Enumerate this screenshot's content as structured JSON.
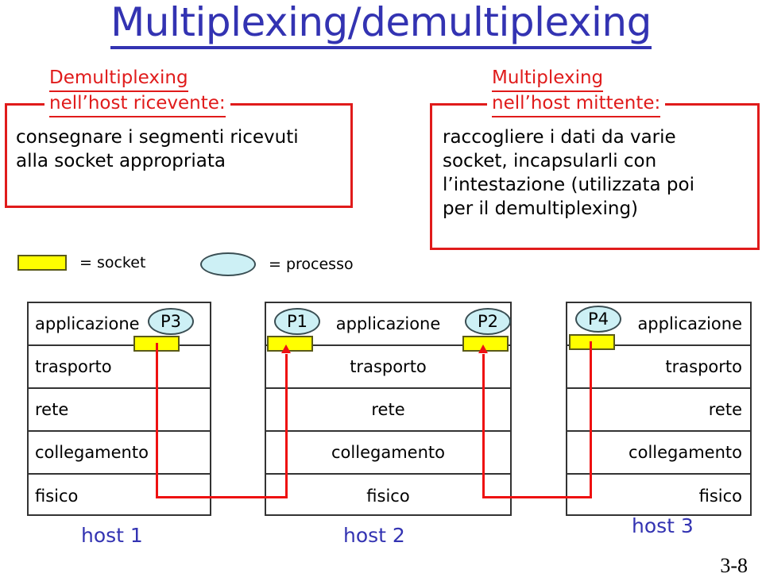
{
  "slide": {
    "title": "Multiplexing/demultiplexing",
    "page_number": "3-8",
    "title_color": "#3333B2",
    "accent_red": "#E01B1B",
    "socket_fill": "#FFFF00",
    "process_fill": "#CDF0F5"
  },
  "demux_callout": {
    "heading_line1": "Demultiplexing",
    "heading_line2": "nell’host ricevente:",
    "body_line1": "consegnare i segmenti ricevuti",
    "body_line2": "alla socket appropriata"
  },
  "mux_callout": {
    "heading_line1": "Multiplexing",
    "heading_line2": "nell’host mittente:",
    "body_line1": "raccogliere i dati da varie",
    "body_line2": "socket, incapsularli con",
    "body_line3": "l’intestazione (utilizzata poi",
    "body_line4": "per il demultiplexing)"
  },
  "legend": {
    "socket_label": "= socket",
    "processo_label": "= processo"
  },
  "hosts": [
    {
      "caption": "host 1",
      "layers": [
        "applicazione",
        "trasporto",
        "rete",
        "collegamento",
        "fisico"
      ],
      "processes": [
        "P3"
      ]
    },
    {
      "caption": "host 2",
      "layers": [
        "applicazione",
        "trasporto",
        "rete",
        "collegamento",
        "fisico"
      ],
      "processes": [
        "P1",
        "P2"
      ]
    },
    {
      "caption": "host 3",
      "layers": [
        "applicazione",
        "trasporto",
        "rete",
        "collegamento",
        "fisico"
      ],
      "processes": [
        "P4"
      ]
    }
  ]
}
